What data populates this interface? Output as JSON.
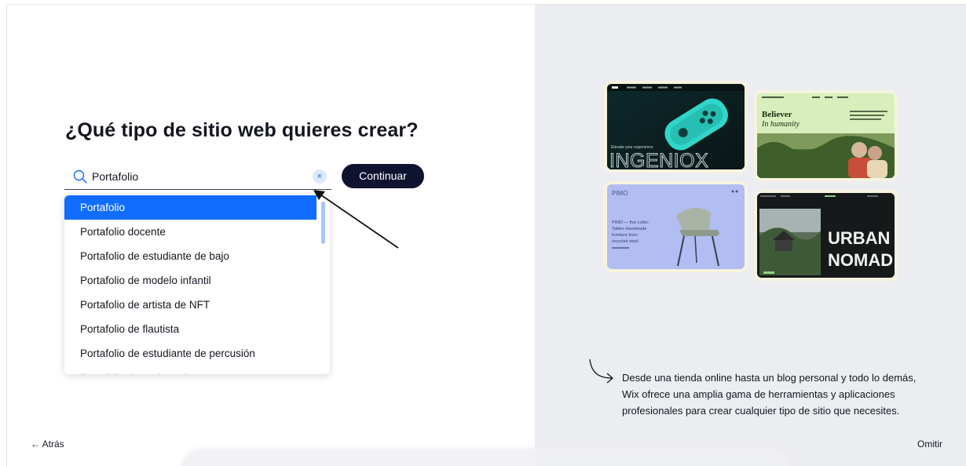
{
  "page": {
    "title": "¿Qué tipo de sitio web quieres crear?"
  },
  "search": {
    "value": "Portafolio",
    "clear_glyph": "×"
  },
  "continue_label": "Continuar",
  "dropdown": {
    "options": [
      "Portafolio",
      "Portafolio docente",
      "Portafolio de estudiante de bajo",
      "Portafolio de modelo infantil",
      "Portafolio de artista de NFT",
      "Portafolio de flautista",
      "Portafolio de estudiante de percusión",
      "Portafolio de pedagogía"
    ],
    "selected_index": 0
  },
  "footer": {
    "back_label": "← Atrás",
    "skip_label": "Omitir"
  },
  "showcase": {
    "templates": [
      {
        "name": "INGENIOX",
        "tagline": "Elevate your experience"
      },
      {
        "name": "Believer",
        "tagline": "In humanity"
      },
      {
        "name": "PIMO",
        "tagline": "Handmade furniture from recycled steel"
      },
      {
        "name": "URBAN NOMAD",
        "tagline": ""
      }
    ],
    "caption": "Desde una tienda online hasta un blog personal y todo lo demás, Wix ofrece una amplia gama de herramientas y aplicaciones profesionales para crear cualquier tipo de sitio que necesites."
  },
  "colors": {
    "accent": "#116dff",
    "button_dark": "#0e1330",
    "right_panel": "#ecedf1"
  }
}
